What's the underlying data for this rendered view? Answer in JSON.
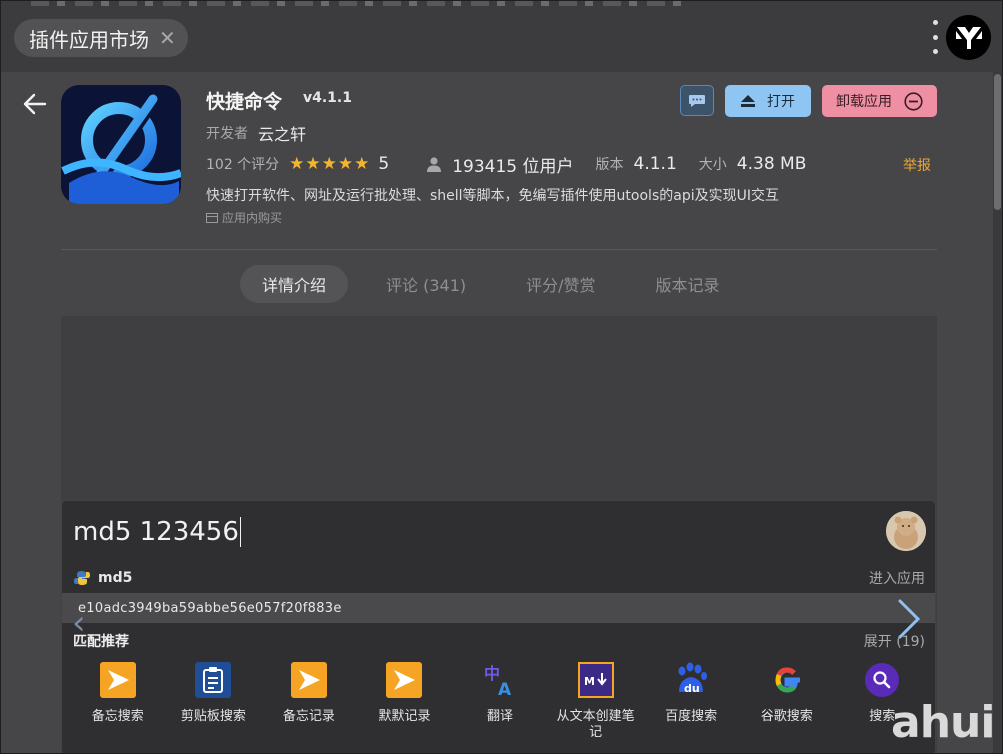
{
  "window": {
    "search_pill": "插件应用市场",
    "close_glyph": "✕"
  },
  "app": {
    "name": "快捷命令",
    "version": "v4.1.1",
    "developer_label": "开发者",
    "developer": "云之轩",
    "rating_count": "102 个评分",
    "stars": "★★★★★",
    "rating_value": "5",
    "rating_fraction": 1.0,
    "users": "193415 位用户",
    "version_label": "版本",
    "version_value": "4.1.1",
    "size_label": "大小",
    "size_value": "4.38 MB",
    "report": "举报",
    "description": "快速打开软件、网址及运行批处理、shell等脚本，免编写插件使用utools的api及实现UI交互",
    "in_app_purchase": "应用内购买"
  },
  "actions": {
    "open": "打开",
    "uninstall": "卸载应用"
  },
  "tabs": [
    {
      "label": "详情介绍",
      "active": true
    },
    {
      "label": "评论 (341)",
      "active": false
    },
    {
      "label": "评分/赞赏",
      "active": false
    },
    {
      "label": "版本记录",
      "active": false
    }
  ],
  "screenshot": {
    "input": "md5 123456",
    "plugin_name": "md5",
    "enter_app": "进入应用",
    "hash": "e10adc3949ba59abbe56e057f20f883e",
    "recommend_title": "匹配推荐",
    "expand": "展开 (19)",
    "apps": [
      {
        "label": "备忘搜索",
        "icon": "star-ticket-icon"
      },
      {
        "label": "剪贴板搜索",
        "icon": "clipboard-icon"
      },
      {
        "label": "备忘记录",
        "icon": "star-ticket-icon"
      },
      {
        "label": "默默记录",
        "icon": "star-ticket-icon"
      },
      {
        "label": "翻译",
        "icon": "translate-icon"
      },
      {
        "label": "从文本创建笔记",
        "icon": "markdown-icon"
      },
      {
        "label": "百度搜索",
        "icon": "baidu-icon"
      },
      {
        "label": "谷歌搜索",
        "icon": "google-icon"
      },
      {
        "label": "搜索",
        "icon": "search-icon"
      }
    ]
  },
  "watermark": "ahui",
  "colors": {
    "accent_blue": "#8ec5f3",
    "danger_pink": "#ef8fa4",
    "star": "#f6b42b",
    "report": "#f0a630"
  }
}
